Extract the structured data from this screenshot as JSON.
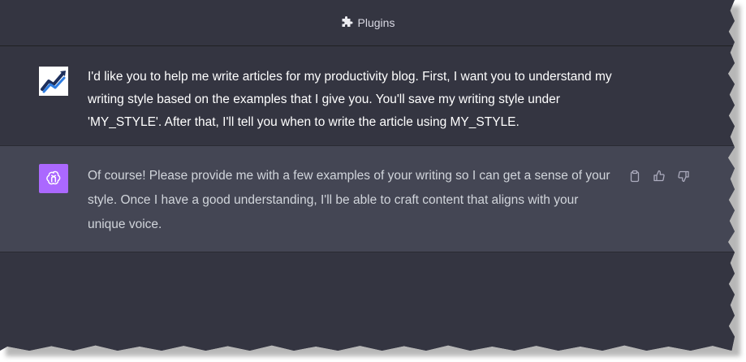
{
  "header": {
    "title": "Plugins",
    "icon": "puzzle-icon"
  },
  "conversation": {
    "user_message": {
      "avatar": "chart-logo-avatar",
      "text": "I'd like you to help me write articles for my productivity blog. First, I want you to understand my writing style based on the examples that I give you. You'll save my writing style under 'MY_STYLE'. After that, I'll tell you when to write the article using MY_STYLE."
    },
    "assistant_message": {
      "avatar": "openai-logo-icon",
      "text": "Of course! Please provide me with a few examples of your writing so I can get a sense of your style. Once I have a good understanding, I'll be able to craft content that aligns with your unique voice.",
      "actions": [
        "clipboard-icon",
        "thumbs-up-icon",
        "thumbs-down-icon"
      ]
    }
  },
  "colors": {
    "background": "#343541",
    "assistant_background": "#444654",
    "assistant_avatar": "#ab68ff",
    "text": "#ececf1"
  }
}
